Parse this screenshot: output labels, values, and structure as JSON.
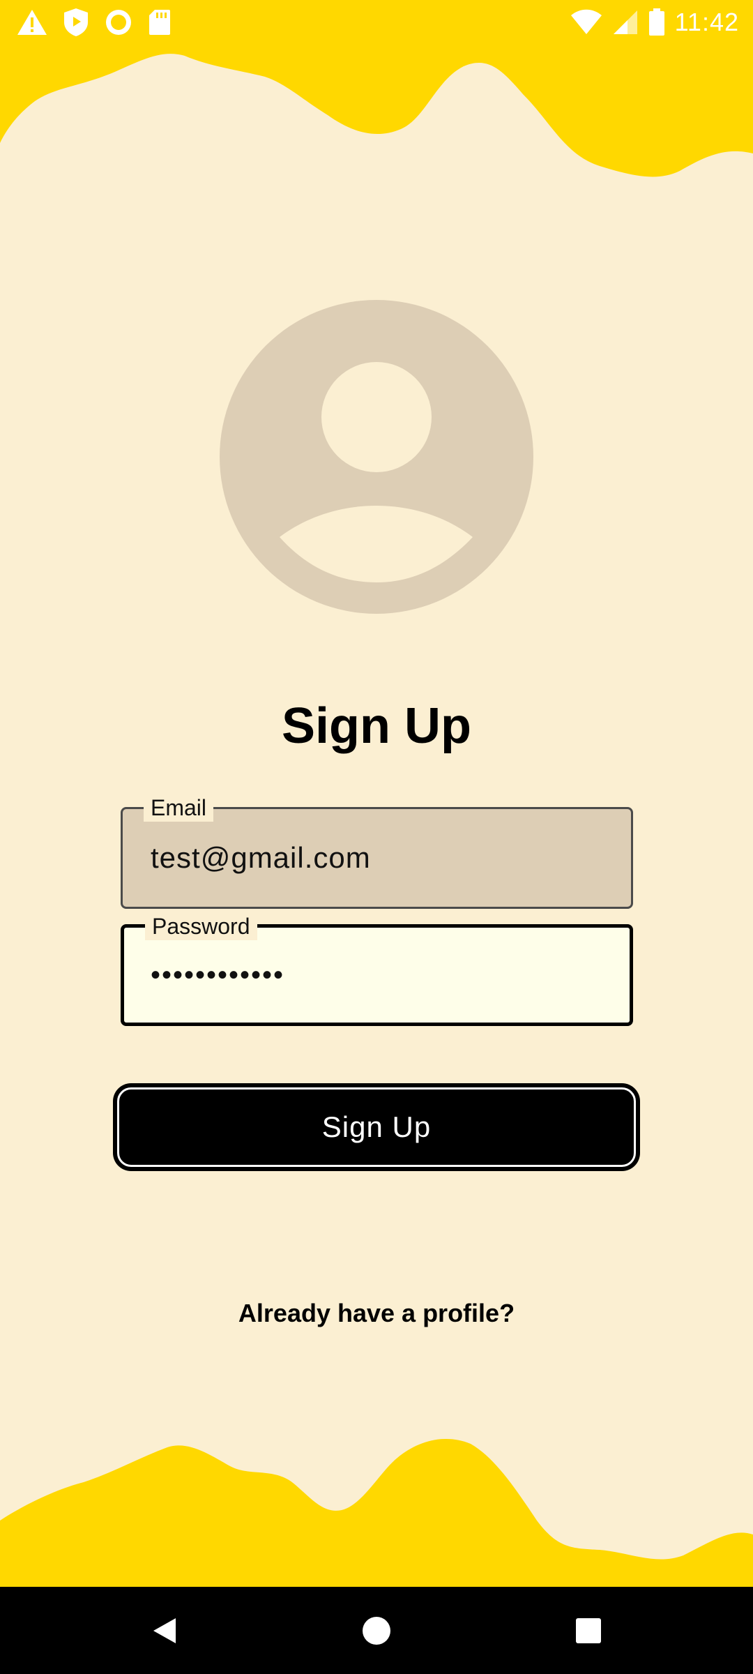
{
  "status_bar": {
    "time": "11:42",
    "left_icons": [
      "warning-icon",
      "shield-play-icon",
      "circle-icon",
      "sd-card-icon"
    ],
    "right_icons": [
      "wifi-icon",
      "signal-icon",
      "battery-icon"
    ]
  },
  "avatar": {
    "icon": "user-avatar-icon"
  },
  "title": "Sign Up",
  "form": {
    "email": {
      "label": "Email",
      "value": "test@gmail.com"
    },
    "password": {
      "label": "Password",
      "value": "••••••••••••"
    },
    "submit_label": "Sign Up"
  },
  "footer_link": "Already have a profile?",
  "nav_bar": {
    "buttons": [
      "back-icon",
      "home-icon",
      "recents-icon"
    ]
  },
  "colors": {
    "background": "#FBEFD2",
    "wave": "#FFD800",
    "avatar": "#DDCEB5",
    "email_field": "#DDCEB5",
    "password_field": "#FEFEE9",
    "button": "#000000"
  }
}
